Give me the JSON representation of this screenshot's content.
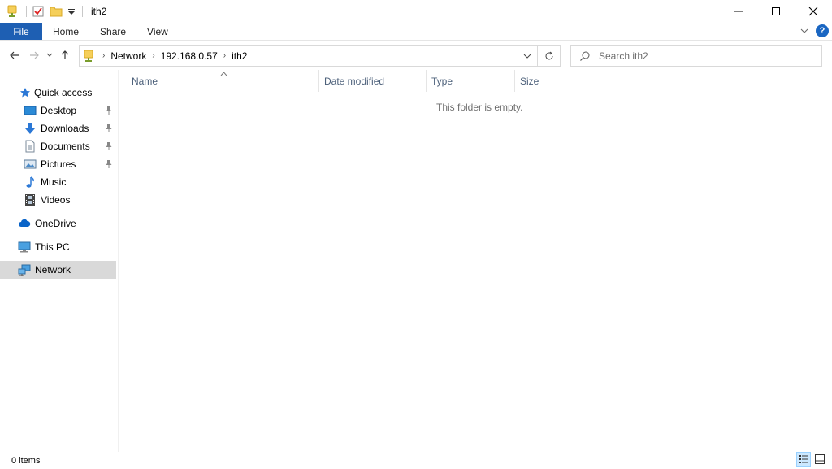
{
  "window": {
    "title": "ith2",
    "controls": {
      "minimize": "—",
      "maximize": "☐",
      "close": "✕"
    }
  },
  "ribbon": {
    "tabs": [
      {
        "label": "File"
      },
      {
        "label": "Home"
      },
      {
        "label": "Share"
      },
      {
        "label": "View"
      }
    ],
    "help_label": "?"
  },
  "address": {
    "crumbs": [
      "Network",
      "192.168.0.57",
      "ith2"
    ]
  },
  "search": {
    "placeholder": "Search ith2"
  },
  "sidebar": {
    "items": [
      {
        "label": "Quick access"
      },
      {
        "label": "Desktop"
      },
      {
        "label": "Downloads"
      },
      {
        "label": "Documents"
      },
      {
        "label": "Pictures"
      },
      {
        "label": "Music"
      },
      {
        "label": "Videos"
      },
      {
        "label": "OneDrive"
      },
      {
        "label": "This PC"
      },
      {
        "label": "Network"
      }
    ]
  },
  "columns": {
    "name": "Name",
    "date_modified": "Date modified",
    "type": "Type",
    "size": "Size"
  },
  "content": {
    "empty_message": "This folder is empty."
  },
  "status": {
    "item_count": "0 items"
  },
  "colors": {
    "file_tab": "#1e5fb3",
    "selected_nav": "#d9d9d9",
    "column_header_text": "#4c607a",
    "accent_blue": "#1a66c2"
  }
}
